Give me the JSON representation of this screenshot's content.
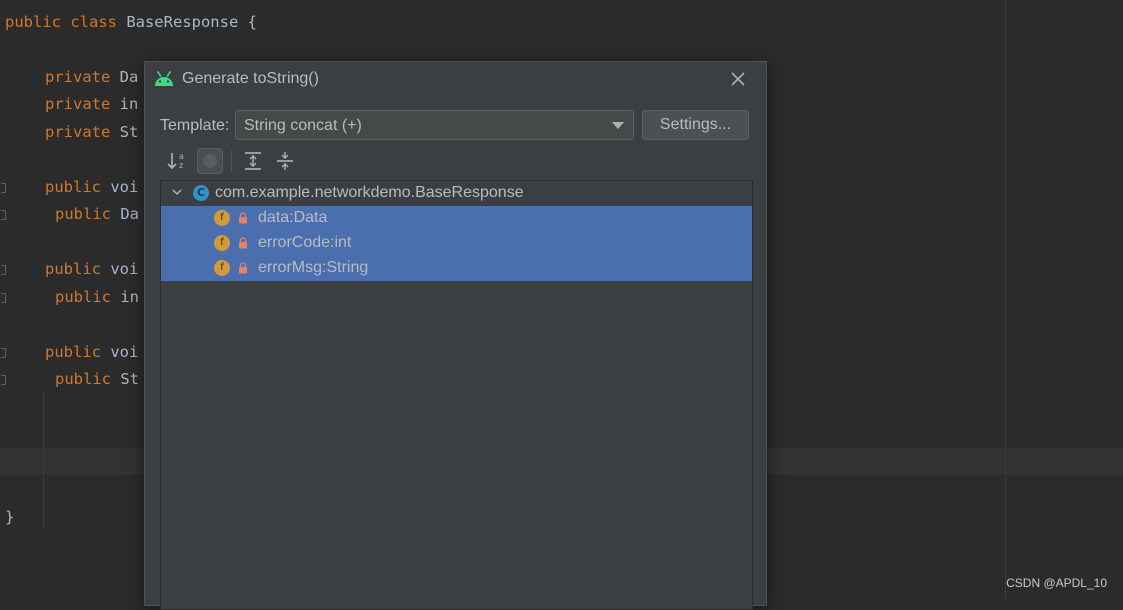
{
  "editor": {
    "lines": [
      {
        "kw": "public class",
        "text": " BaseResponse {"
      },
      {
        "kw": "private",
        "text": " Da"
      },
      {
        "kw": "private",
        "text": " in"
      },
      {
        "kw": "private",
        "text": " St"
      },
      {
        "kw": "public",
        "text": " voi"
      },
      {
        "kw": "public",
        "text": " Da"
      },
      {
        "kw": "public",
        "text": " voi"
      },
      {
        "kw": "public",
        "text": " in"
      },
      {
        "kw": "public",
        "text": " voi"
      },
      {
        "kw": "public",
        "text": " St"
      },
      {
        "kw": "",
        "text": "}"
      }
    ]
  },
  "dialog": {
    "title": "Generate toString()",
    "template_label": "Template:",
    "template_value": "String concat (+)",
    "settings_label": "Settings...",
    "tree": {
      "root": "com.example.networkdemo.BaseResponse",
      "root_icon_letter": "C",
      "field_icon_letter": "f",
      "fields": [
        {
          "label": "data:Data"
        },
        {
          "label": "errorCode:int"
        },
        {
          "label": "errorMsg:String"
        }
      ]
    }
  },
  "watermark": "CSDN @APDL_10",
  "colors": {
    "keyword": "#cc7832",
    "selection": "#4b6eaf",
    "android_green": "#3ddc84"
  }
}
